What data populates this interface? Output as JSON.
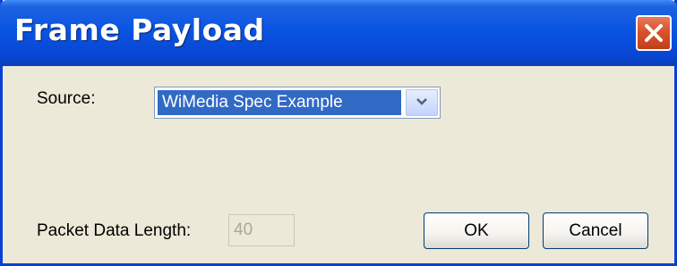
{
  "window": {
    "title": "Frame Payload",
    "close_icon": "close-icon"
  },
  "source": {
    "label": "Source:",
    "selected": "WiMedia Spec Example",
    "arrow_icon": "chevron-down-icon"
  },
  "packet": {
    "label": "Packet Data Length:",
    "value": "40"
  },
  "buttons": {
    "ok": "OK",
    "cancel": "Cancel"
  }
}
